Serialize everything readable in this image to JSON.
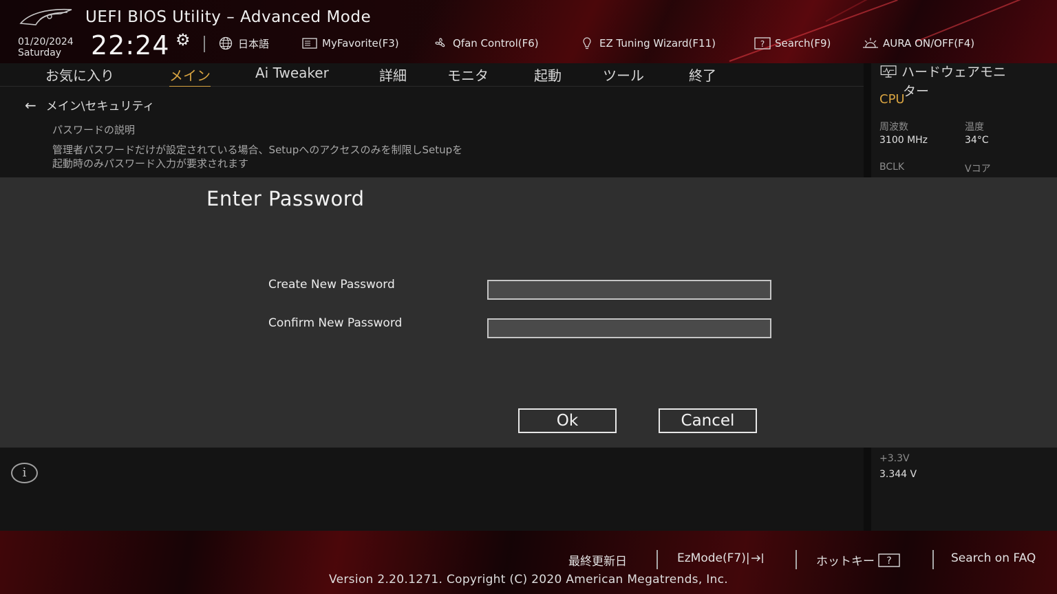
{
  "header": {
    "title": "UEFI BIOS Utility – Advanced Mode",
    "date": "01/20/2024",
    "day": "Saturday",
    "time": "22:24",
    "tools": [
      {
        "label": "日本語",
        "icon": "globe-icon"
      },
      {
        "label": "MyFavorite(F3)",
        "icon": "favorite-icon"
      },
      {
        "label": "Qfan Control(F6)",
        "icon": "fan-icon"
      },
      {
        "label": "EZ Tuning Wizard(F11)",
        "icon": "bulb-icon"
      },
      {
        "label": "Search(F9)",
        "icon": "search-help-icon"
      },
      {
        "label": "AURA ON/OFF(F4)",
        "icon": "aura-icon"
      }
    ]
  },
  "tabs": [
    {
      "label": "お気に入り"
    },
    {
      "label": "メイン",
      "active": true
    },
    {
      "label": "Ai Tweaker"
    },
    {
      "label": "詳細"
    },
    {
      "label": "モニタ"
    },
    {
      "label": "起動"
    },
    {
      "label": "ツール"
    },
    {
      "label": "終了"
    }
  ],
  "main": {
    "breadcrumb": "メイン\\セキュリティ",
    "desc_title": "パスワードの説明",
    "desc_line1": "管理者パスワードだけが設定されている場合、Setupへのアクセスのみを制限しSetupを",
    "desc_line2": "起動時のみパスワード入力が要求されます"
  },
  "hardware_monitor": {
    "title_line1": "ハードウェアモニ",
    "title_line2": "ター",
    "section": "CPU",
    "freq_label": "周波数",
    "freq_value": "3100 MHz",
    "temp_label": "温度",
    "temp_value": "34°C",
    "bclk_label": "BCLK",
    "vcore_label": "Vコア",
    "v33_label": "+3.3V",
    "v33_value": "3.344 V"
  },
  "modal": {
    "title": "Enter Password",
    "create_label": "Create New Password",
    "confirm_label": "Confirm New Password",
    "create_value": "",
    "confirm_value": "",
    "ok_label": "Ok",
    "cancel_label": "Cancel"
  },
  "footer": {
    "last_modified": "最終更新日",
    "ezmode": "EzMode(F7)|",
    "hotkeys": "ホットキー",
    "faq": "Search on FAQ",
    "copyright": "Version 2.20.1271. Copyright (C) 2020 American Megatrends, Inc."
  },
  "colors": {
    "accent": "#d9a441",
    "brand_red": "#8a0a10",
    "modal_bg": "#2f2f2f"
  }
}
